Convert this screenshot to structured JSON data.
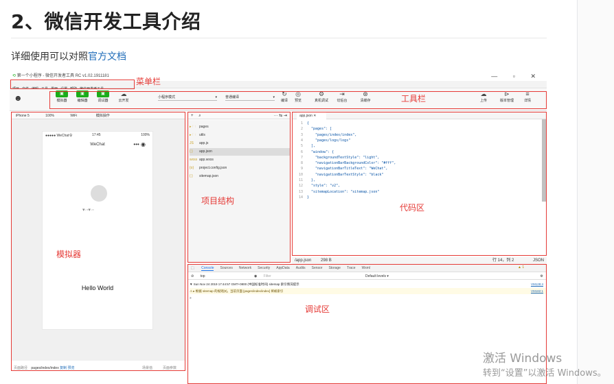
{
  "doc": {
    "title": "2、微信开发工具介绍",
    "intro_text": "详细使用可以对照",
    "intro_link": "官方文档"
  },
  "window": {
    "title": "第一个小程序 - 微信开发者工具 RC v1.02.1911181",
    "controls": "—  ▫  ✕"
  },
  "menubar": {
    "items": [
      "项目",
      "文件",
      "编辑",
      "工具",
      "界面",
      "设置",
      "帮助",
      "微信开发者工具"
    ],
    "label": "菜单栏"
  },
  "toolbar": {
    "label": "工具栏",
    "buttons": [
      "模拟器",
      "编辑器",
      "调试器",
      "云开发"
    ],
    "mode_select": "小程序模式",
    "compile_select": "普通编译",
    "actions": [
      "编译",
      "预览",
      "真机调试",
      "切后台",
      "清缓存"
    ],
    "right_actions": [
      "上传",
      "版本管理",
      "详情"
    ]
  },
  "simulator": {
    "label": "模拟器",
    "device": "iPhone 5",
    "zoom": "100%",
    "network": "WiFi",
    "sim_ops": "模拟操作",
    "status_left": "●●●●● WeChat令",
    "status_time": "17:45",
    "status_right": "100%",
    "nav_title": "WeChat",
    "hello": "Hello World",
    "footer_path_label": "页面路径",
    "footer_path": "pages/index/index",
    "footer_copy": "复制",
    "footer_preview": "预览",
    "footer_scene": "场景值",
    "footer_params": "页面参数"
  },
  "tree": {
    "label": "项目结构",
    "items": [
      {
        "icon": "▸ 🗀",
        "name": "pages"
      },
      {
        "icon": "▸ 🗀",
        "name": "utils"
      },
      {
        "icon": "JS",
        "name": "app.js"
      },
      {
        "icon": "{ }",
        "name": "app.json"
      },
      {
        "icon": "wxss",
        "name": "app.wxss"
      },
      {
        "icon": "{o}",
        "name": "project.config.json"
      },
      {
        "icon": "{ }",
        "name": "sitemap.json"
      }
    ]
  },
  "code": {
    "label": "代码区",
    "tab": "app.json",
    "lines": [
      "{",
      "  \"pages\": [",
      "    \"pages/index/index\",",
      "    \"pages/logs/logs\"",
      "  ],",
      "  \"window\": {",
      "    \"backgroundTextStyle\": \"light\",",
      "    \"navigationBarBackgroundColor\": \"#fff\",",
      "    \"navigationBarTitleText\": \"WeChat\",",
      "    \"navigationBarTextStyle\": \"black\"",
      "  },",
      "  \"style\": \"v2\",",
      "  \"sitemapLocation\": \"sitemap.json\"",
      "}"
    ],
    "status_file": "/app.json",
    "status_size": "298 B",
    "status_pos": "行 14，列 2",
    "status_lang": "JSON"
  },
  "debug": {
    "label": "调试区",
    "tabs": [
      "Console",
      "Sources",
      "Network",
      "Security",
      "AppData",
      "Audits",
      "Sensor",
      "Storage",
      "Trace",
      "Wxml"
    ],
    "context": "top",
    "filter_placeholder": "Filter",
    "levels": "Default levels ▾",
    "warn_count": "▲ 1",
    "logs": [
      {
        "text": "▼ Sun Nov 24 2019 17:44:57 GMT+0800 (中国标准时间) sitemap 索引情况提示",
        "src": "VM128:4"
      },
      {
        "text": "⚠ ▸ 根据 sitemap 的规则[0]，当前页面 [pages/index/index] 将被索引",
        "src": "VM182:1"
      },
      {
        "text": ">",
        "src": ""
      }
    ]
  },
  "watermark": {
    "line1": "激活 Windows",
    "line2": "转到“设置”以激活 Windows。"
  }
}
